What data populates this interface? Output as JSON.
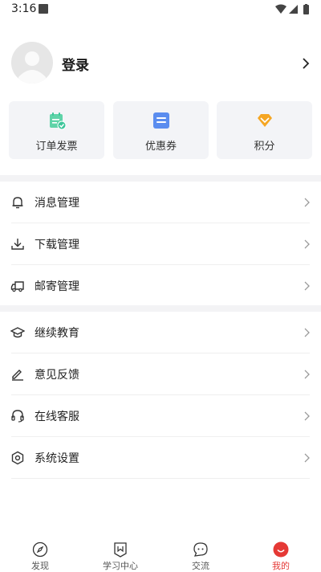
{
  "status_bar": {
    "time": "3:16"
  },
  "profile": {
    "login_label": "登录"
  },
  "quick_cards": [
    {
      "label": "订单发票",
      "icon": "invoice-icon"
    },
    {
      "label": "优惠券",
      "icon": "coupon-icon"
    },
    {
      "label": "积分",
      "icon": "diamond-icon"
    }
  ],
  "menu": {
    "group1": [
      {
        "label": "消息管理",
        "icon": "bell-icon"
      },
      {
        "label": "下载管理",
        "icon": "download-icon"
      },
      {
        "label": "邮寄管理",
        "icon": "truck-icon"
      }
    ],
    "group2": [
      {
        "label": "继续教育",
        "icon": "graduation-cap-icon"
      },
      {
        "label": "意见反馈",
        "icon": "edit-icon"
      },
      {
        "label": "在线客服",
        "icon": "headset-icon"
      },
      {
        "label": "系统设置",
        "icon": "settings-icon"
      }
    ]
  },
  "bottom_nav": [
    {
      "label": "发现",
      "icon": "compass-icon"
    },
    {
      "label": "学习中心",
      "icon": "book-icon"
    },
    {
      "label": "交流",
      "icon": "chat-icon"
    },
    {
      "label": "我的",
      "icon": "profile-icon",
      "active": true
    }
  ],
  "colors": {
    "accent": "#e53935",
    "card_bg": "#f3f4f7",
    "invoice": "#3cc59a",
    "coupon": "#5b8def",
    "diamond": "#f5a623"
  }
}
